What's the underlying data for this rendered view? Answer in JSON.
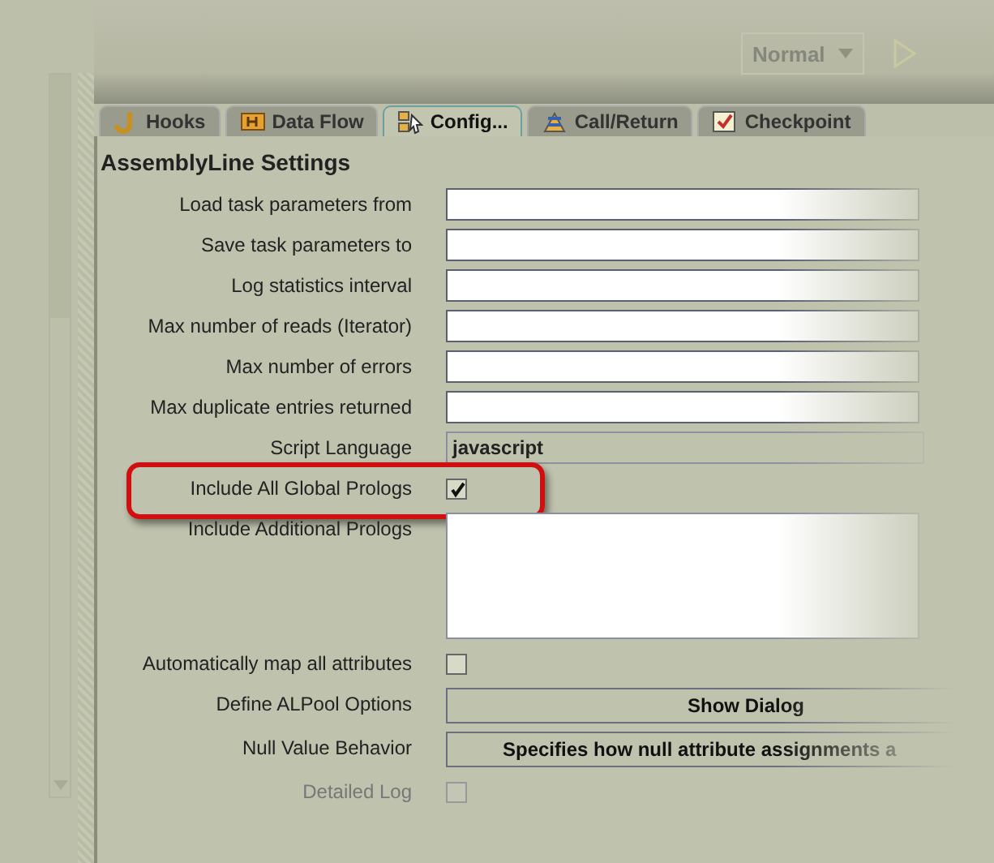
{
  "toolbar": {
    "mode_dropdown": {
      "value": "Normal"
    }
  },
  "tabs": [
    {
      "label": "Hooks",
      "selected": false
    },
    {
      "label": "Data Flow",
      "selected": false
    },
    {
      "label": "Config...",
      "selected": true
    },
    {
      "label": "Call/Return",
      "selected": false
    },
    {
      "label": "Checkpoint",
      "selected": false
    }
  ],
  "panel": {
    "title": "AssemblyLine Settings",
    "rows": [
      {
        "label": "Load task parameters from",
        "kind": "text"
      },
      {
        "label": "Save task parameters to",
        "kind": "text"
      },
      {
        "label": "Log statistics interval",
        "kind": "text"
      },
      {
        "label": "Max number of reads (Iterator)",
        "kind": "text"
      },
      {
        "label": "Max number of errors",
        "kind": "text"
      },
      {
        "label": "Max duplicate entries returned",
        "kind": "text"
      },
      {
        "label": "Script Language",
        "kind": "combo",
        "value": "javascript"
      },
      {
        "label": "Include All Global Prologs",
        "kind": "checkbox",
        "checked": true,
        "highlighted": true
      },
      {
        "label": "Include Additional Prologs",
        "kind": "textarea"
      },
      {
        "label": "Automatically map all attributes",
        "kind": "checkbox",
        "checked": false
      },
      {
        "label": "Define ALPool Options",
        "kind": "button",
        "value": "Show Dialog"
      },
      {
        "label": "Null Value Behavior",
        "kind": "button",
        "value": "Specifies how null attribute assignments a"
      },
      {
        "label": "Detailed Log",
        "kind": "checkbox",
        "checked": false,
        "disabled": true
      }
    ]
  }
}
